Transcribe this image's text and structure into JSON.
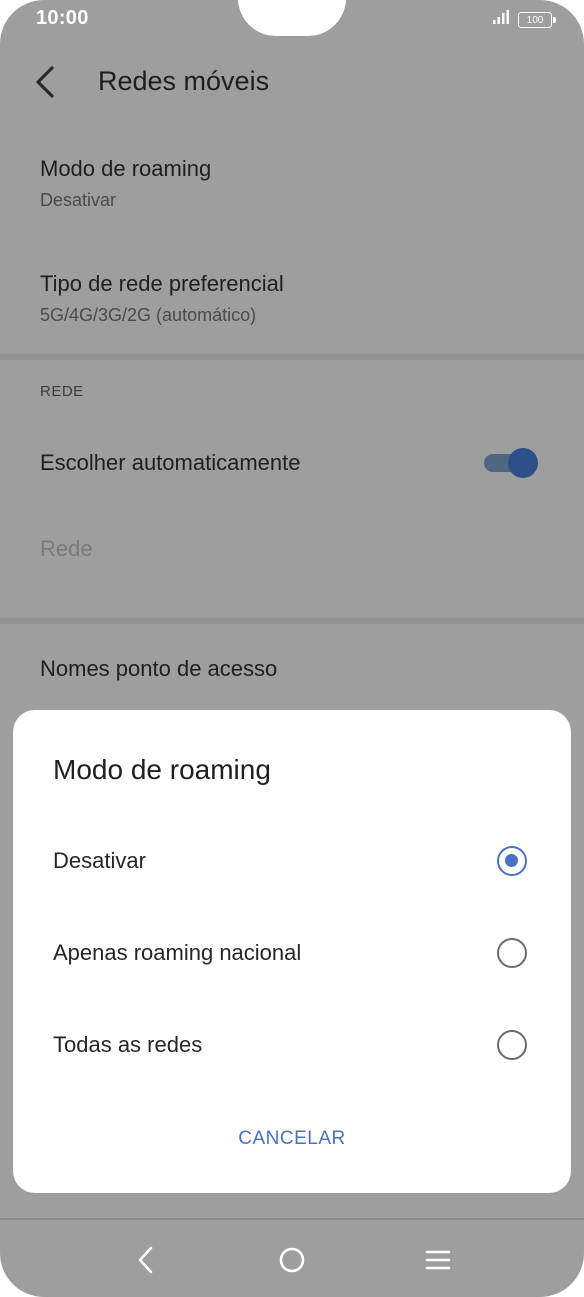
{
  "status": {
    "time": "10:00",
    "battery": "100"
  },
  "header": {
    "title": "Redes móveis"
  },
  "settings": {
    "roaming": {
      "title": "Modo de roaming",
      "value": "Desativar"
    },
    "network_type": {
      "title": "Tipo de rede preferencial",
      "value": "5G/4G/3G/2G (automático)"
    },
    "section_network": "REDE",
    "auto_select": {
      "label": "Escolher automaticamente",
      "on": true
    },
    "network": {
      "label": "Rede"
    },
    "apn": {
      "label": "Nomes ponto de acesso"
    }
  },
  "dialog": {
    "title": "Modo de roaming",
    "options": [
      {
        "label": "Desativar",
        "selected": true
      },
      {
        "label": "Apenas roaming nacional",
        "selected": false
      },
      {
        "label": "Todas as redes",
        "selected": false
      }
    ],
    "cancel_label": "CANCELAR"
  },
  "colors": {
    "accent": "#4a72c4",
    "scrim": "#9e9e9e"
  }
}
